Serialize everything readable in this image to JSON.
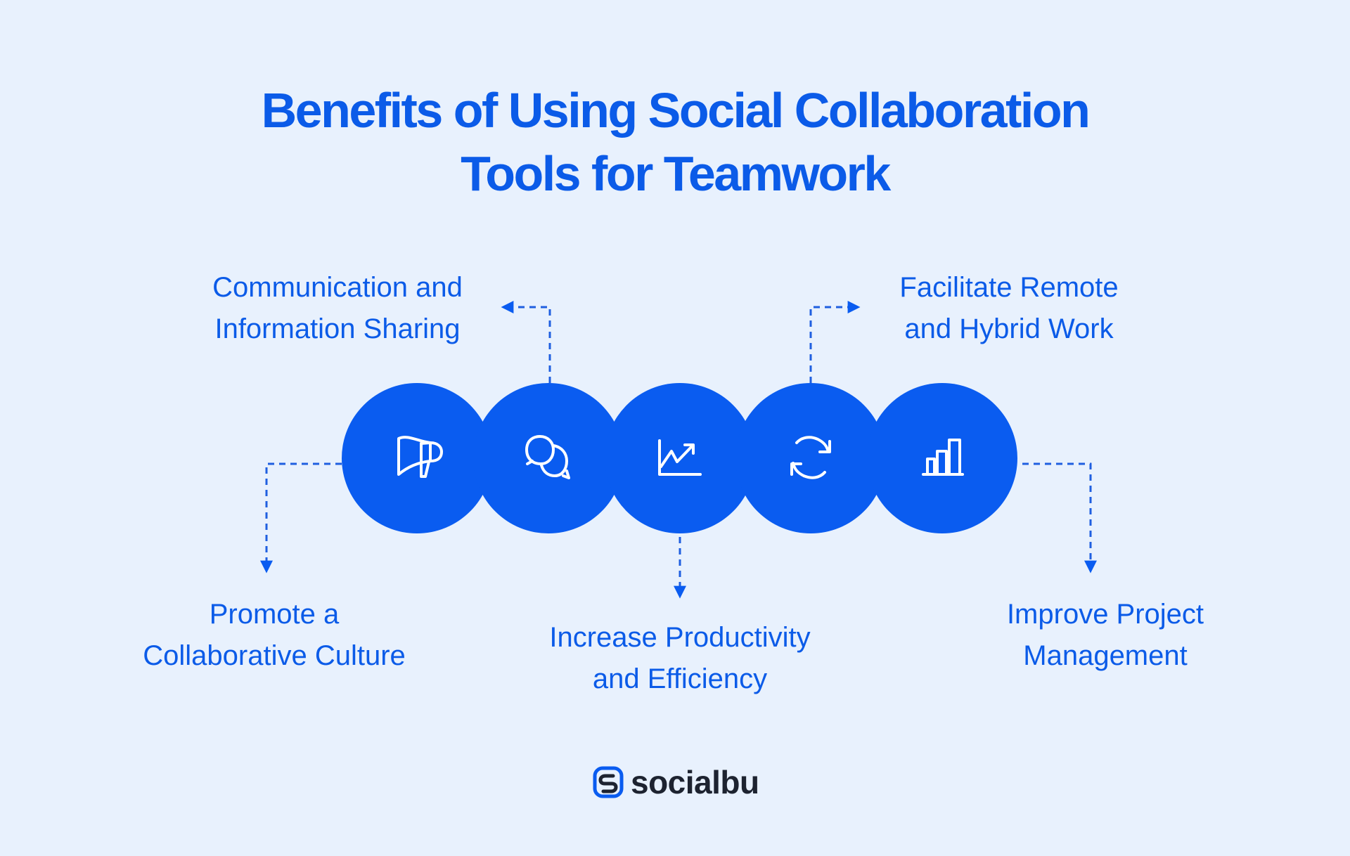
{
  "title": {
    "line1": "Benefits of Using Social Collaboration",
    "line2": "Tools for Teamwork"
  },
  "colors": {
    "background": "#e8f1fd",
    "accent": "#0a5cf0",
    "text": "#0b5be8",
    "icon": "#ffffff",
    "logo_text": "#1d2330"
  },
  "steps": [
    {
      "icon": "megaphone-icon",
      "label_lines": [
        "Promote a",
        "Collaborative Culture"
      ],
      "label_position": "bottom-left"
    },
    {
      "icon": "chat-bubbles-icon",
      "label_lines": [
        "Communication and",
        "Information Sharing"
      ],
      "label_position": "top-left"
    },
    {
      "icon": "trending-chart-icon",
      "label_lines": [
        "Increase Productivity",
        "and Efficiency"
      ],
      "label_position": "bottom"
    },
    {
      "icon": "refresh-icon",
      "label_lines": [
        "Facilitate Remote",
        "and Hybrid Work"
      ],
      "label_position": "top-right"
    },
    {
      "icon": "bar-chart-icon",
      "label_lines": [
        "Improve Project",
        "Management"
      ],
      "label_position": "bottom-right"
    }
  ],
  "logo": {
    "icon": "socialbu-logo-icon",
    "text": "socialbu"
  }
}
